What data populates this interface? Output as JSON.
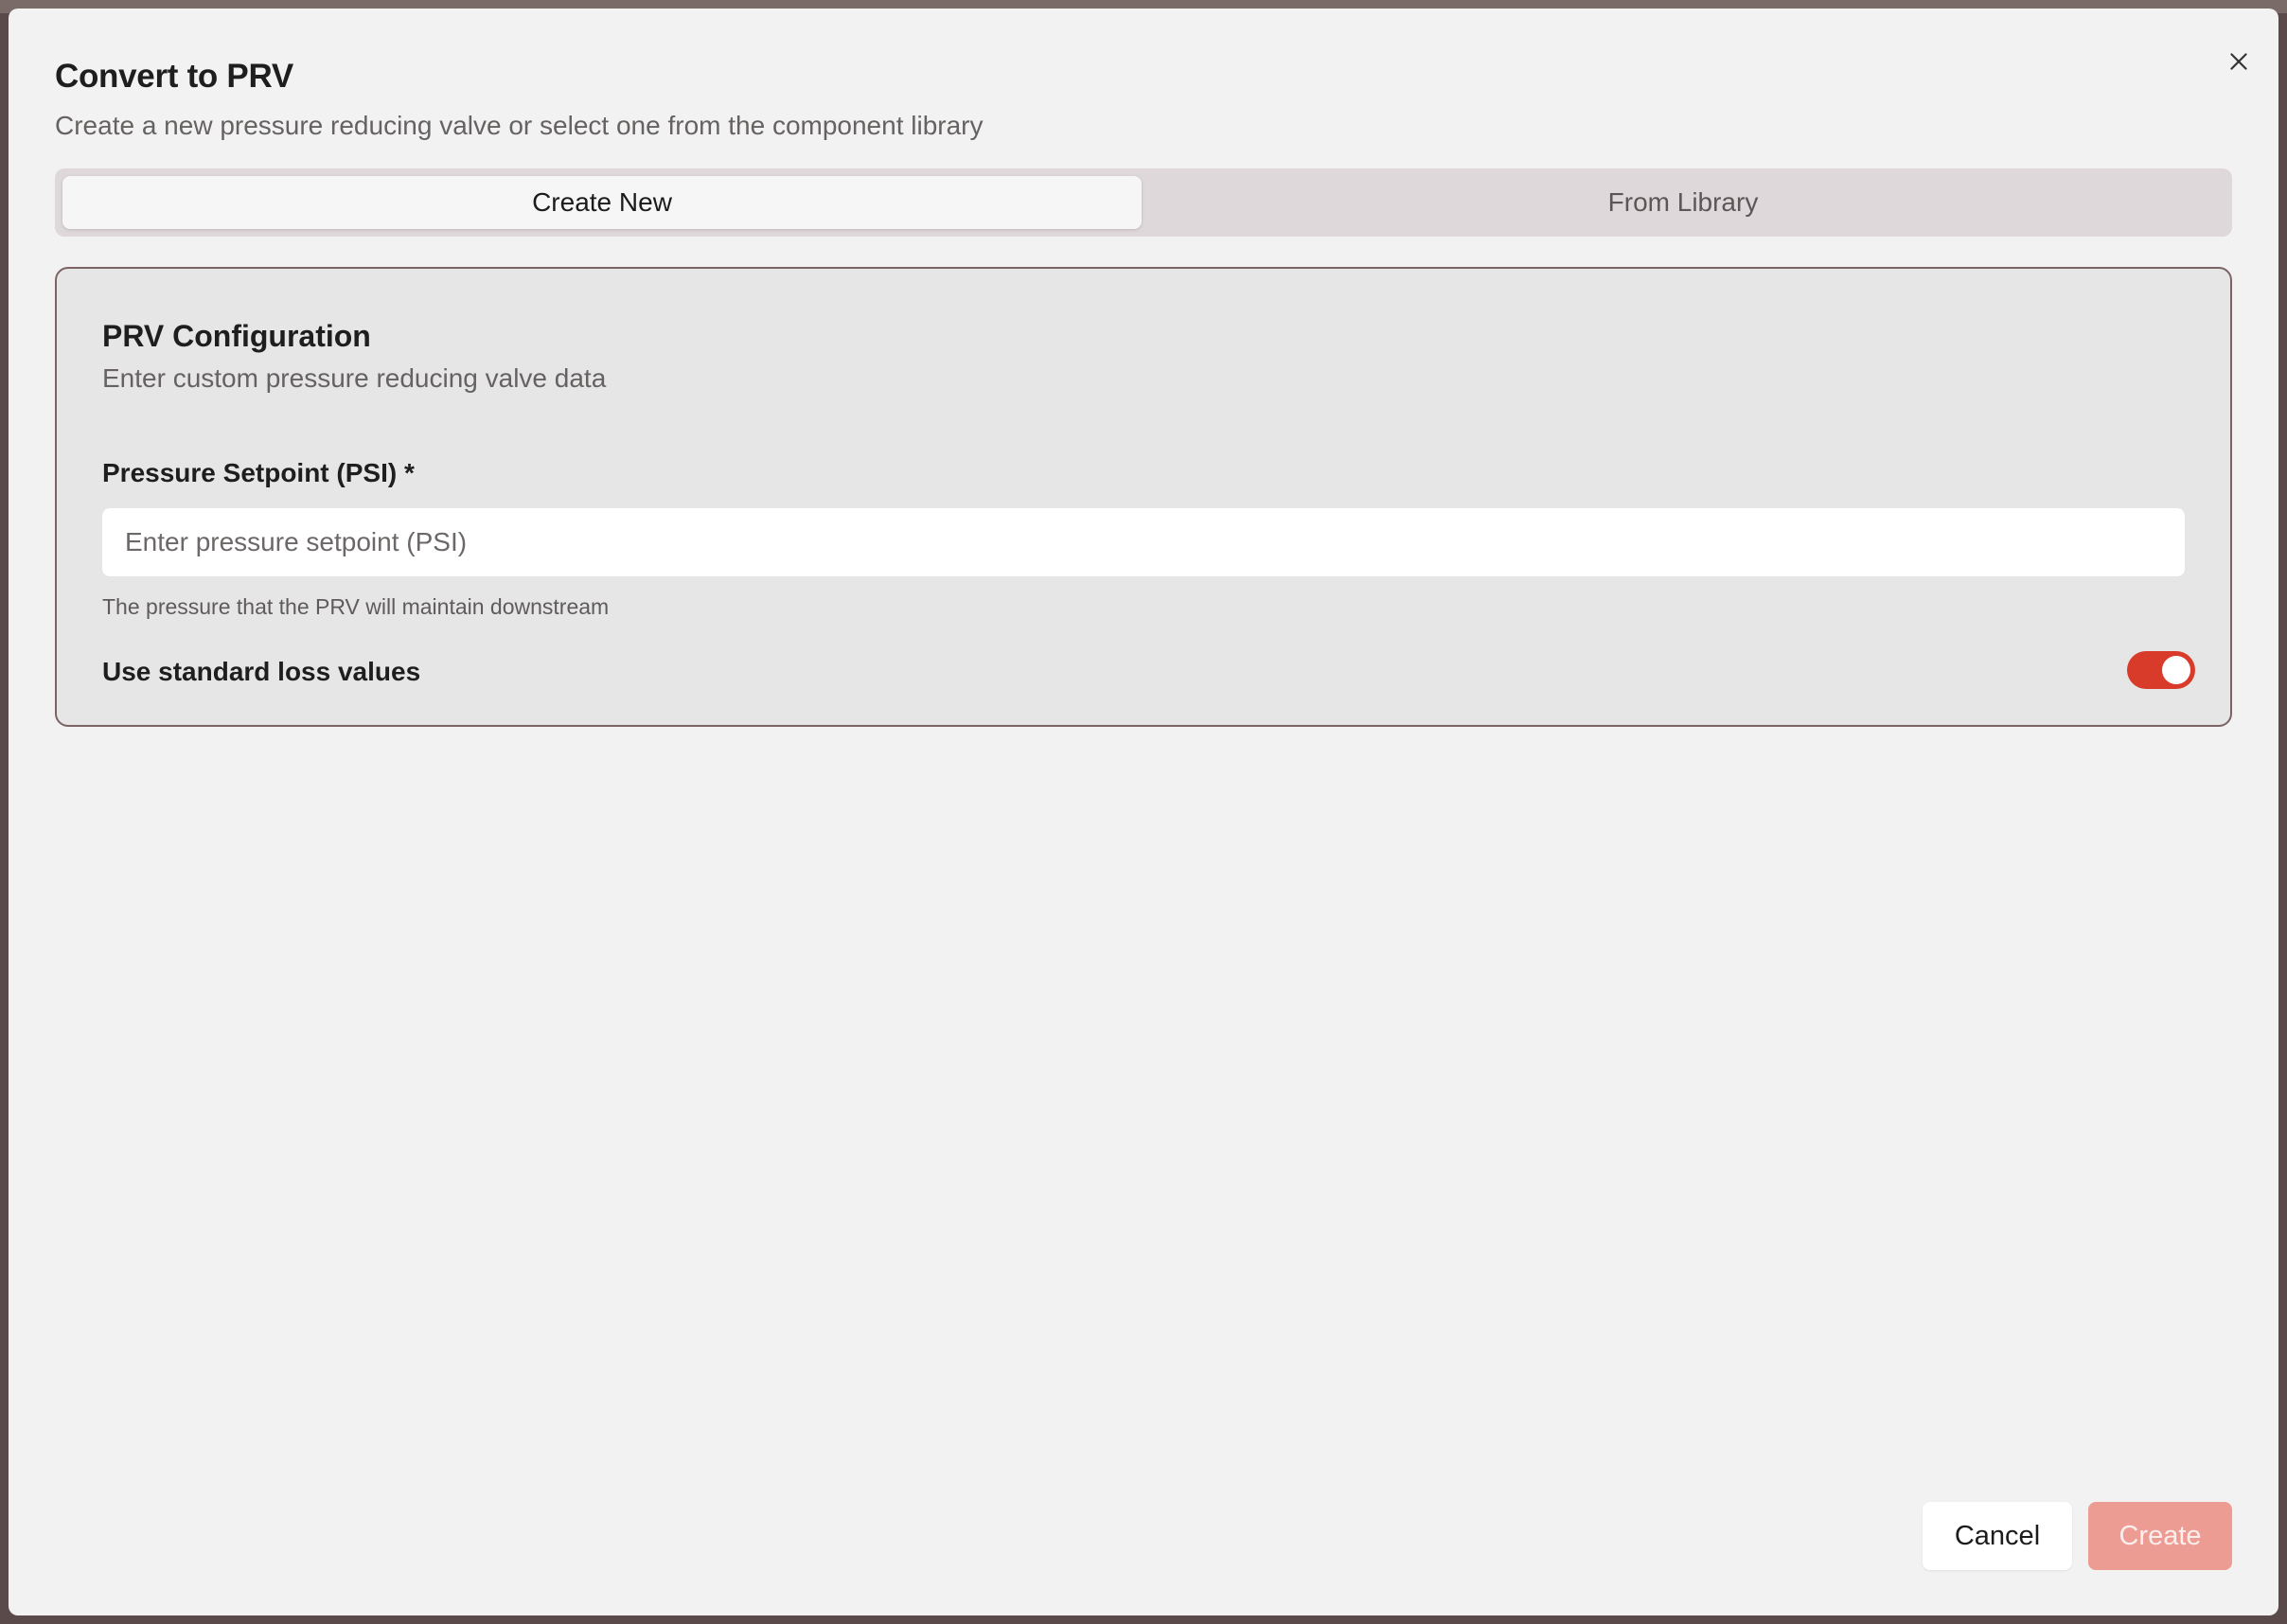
{
  "dialog": {
    "title": "Convert to PRV",
    "subtitle": "Create a new pressure reducing valve or select one from the component library",
    "close_icon": "close-icon"
  },
  "tabs": [
    {
      "label": "Create New",
      "active": true
    },
    {
      "label": "From Library",
      "active": false
    }
  ],
  "config": {
    "title": "PRV Configuration",
    "subtitle": "Enter custom pressure reducing valve data",
    "setpoint": {
      "label": "Pressure Setpoint (PSI) *",
      "value": "",
      "placeholder": "Enter pressure setpoint (PSI)",
      "help": "The pressure that the PRV will maintain downstream"
    },
    "standard_loss": {
      "label": "Use standard loss values",
      "enabled": true
    }
  },
  "footer": {
    "cancel_label": "Cancel",
    "create_label": "Create"
  },
  "colors": {
    "accent": "#d93b2b",
    "create_disabled": "#ec9c93",
    "card_border": "#7c6464"
  }
}
